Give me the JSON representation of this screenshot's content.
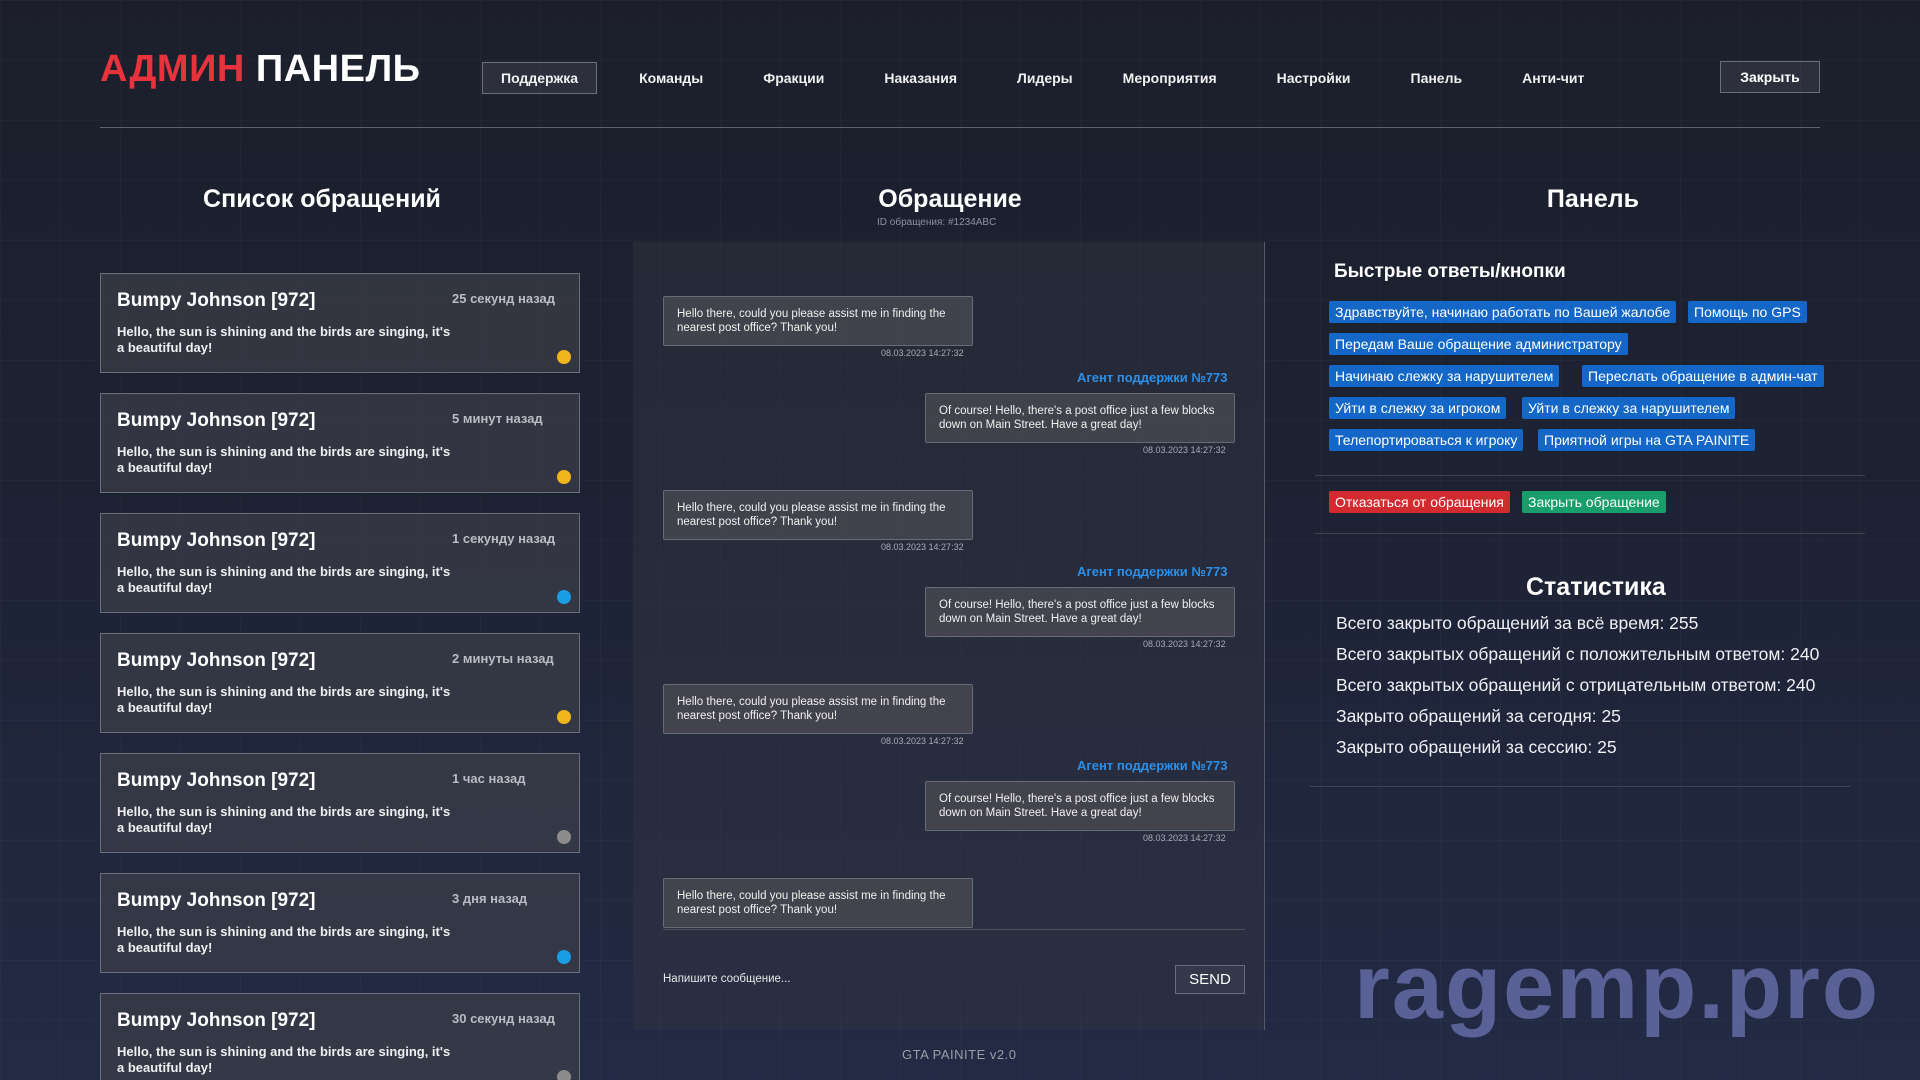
{
  "header": {
    "logo_red": "АДМИН",
    "logo_white": "ПАНЕЛЬ",
    "nav": [
      "Поддержка",
      "Команды",
      "Фракции",
      "Наказания",
      "Лидеры",
      "Мероприятия",
      "Настройки",
      "Панель",
      "Анти-чит"
    ],
    "close_label": "Закрыть"
  },
  "tickets": {
    "title": "Список обращений",
    "items": [
      {
        "name": "Bumpy Johnson [972]",
        "time": "25 секунд назад",
        "msg": "Hello, the sun is shining and the birds are singing, it's a beautiful day!",
        "status_color": "#f1b51c"
      },
      {
        "name": "Bumpy Johnson [972]",
        "time": "5 минут назад",
        "msg": "Hello, the sun is shining and the birds are singing, it's a beautiful day!",
        "status_color": "#f1b51c"
      },
      {
        "name": "Bumpy Johnson [972]",
        "time": "1 секунду назад",
        "msg": "Hello, the sun is shining and the birds are singing, it's a beautiful day!",
        "status_color": "#1a9ee6"
      },
      {
        "name": "Bumpy Johnson [972]",
        "time": "2 минуты назад",
        "msg": "Hello, the sun is shining and the birds are singing, it's a beautiful day!",
        "status_color": "#f1b51c"
      },
      {
        "name": "Bumpy Johnson [972]",
        "time": "1 час назад",
        "msg": "Hello, the sun is shining and the birds are singing, it's a beautiful day!",
        "status_color": "#8c8c8c"
      },
      {
        "name": "Bumpy Johnson [972]",
        "time": "3 дня назад",
        "msg": "Hello, the sun is shining and the birds are singing, it's a beautiful day!",
        "status_color": "#1a9ee6"
      },
      {
        "name": "Bumpy Johnson [972]",
        "time": "30 секунд назад",
        "msg": "Hello, the sun is shining and the birds are singing, it's a beautiful day!",
        "status_color": "#8c8c8c"
      }
    ]
  },
  "chat": {
    "title": "Обращение",
    "id_label": "ID обращения: #1234ABC",
    "user_msg": "Hello there, could you please assist me in finding the nearest post office? Thank you!",
    "agent_name": "Агент поддержки №773",
    "agent_msg": "Of course! Hello, there's a post office just a few blocks down on Main Street. Have a great day!",
    "timestamp": "08.03.2023 14:27:32",
    "input_placeholder": "Напишите сообщение...",
    "send_label": "SEND",
    "version": "GTA PAINITE v2.0"
  },
  "panel": {
    "title": "Панель",
    "quick_title": "Быстрые ответы/кнопки",
    "quick_buttons": [
      "Здравствуйте, начинаю работать по Вашей жалобе",
      "Помощь по GPS",
      "Передам Ваше обращение администратору",
      "Начинаю слежку за нарушителем",
      "Переслать обращение в админ-чат",
      "Уйти в слежку за игроком",
      "Уйти в слежку за нарушителем",
      "Телепортироваться к игроку",
      "Приятной игры на GTA PAINITE"
    ],
    "reject_label": "Отказаться от обращения",
    "close_ticket_label": "Закрыть обращение",
    "stats_title": "Статистика",
    "stats": [
      "Всего закрыто обращений за всё время: 255",
      "Всего закрытых обращений с положительным ответом: 240",
      "Всего закрытых обращений с отрицательным ответом: 240",
      "Закрыто обращений за сегодня: 25",
      "Закрыто обращений за сессию: 25"
    ]
  },
  "watermark": "ragemp.pro"
}
